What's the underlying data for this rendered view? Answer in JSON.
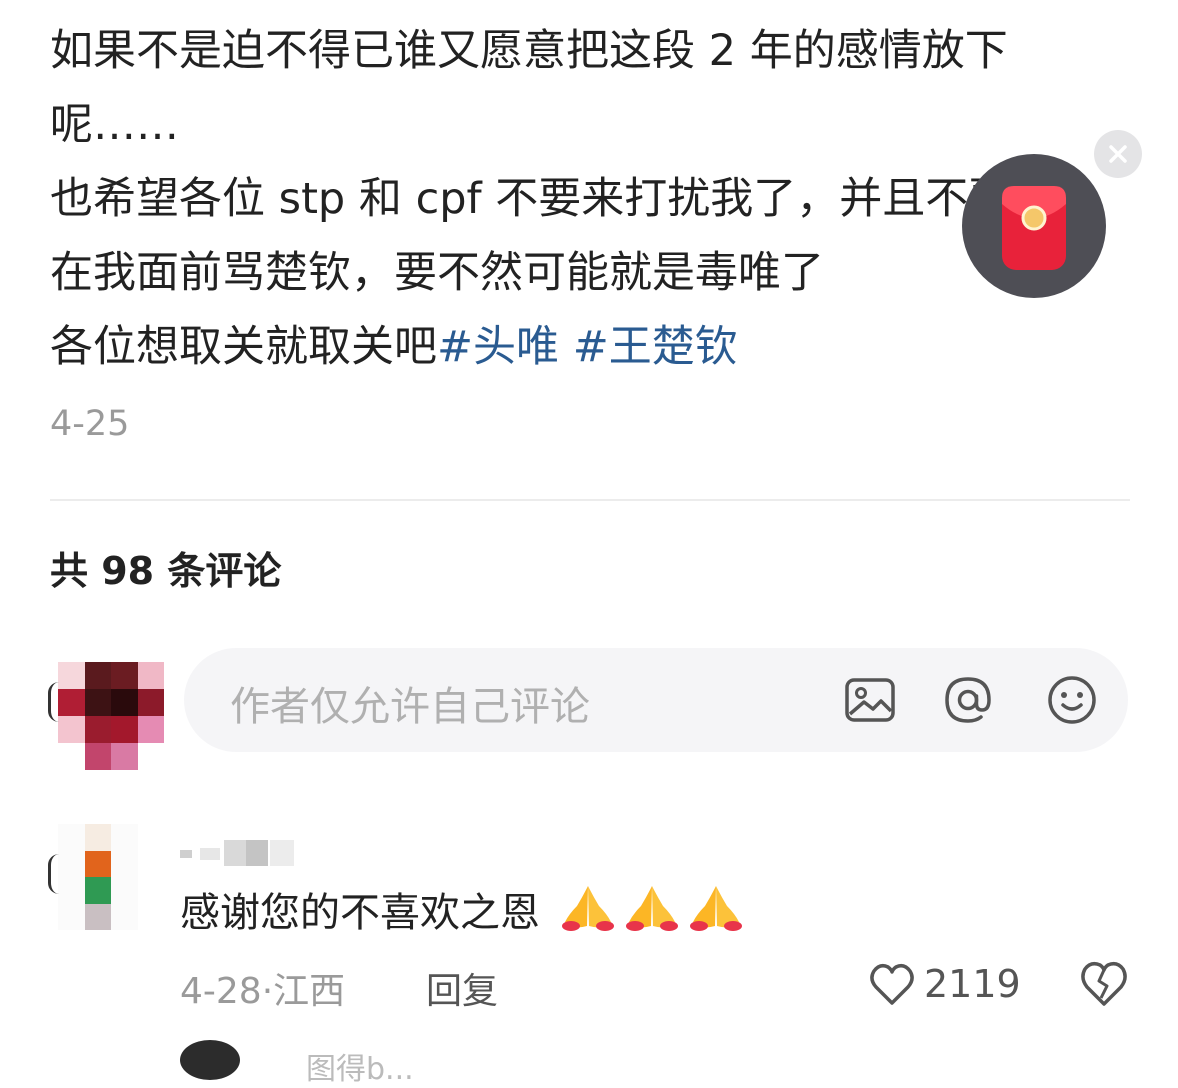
{
  "post": {
    "lines": [
      "如果不是迫不得已谁又愿意把这段 2 年的感情放下",
      "呢……",
      "也希望各位 stp 和 cpf 不要来打扰我了，并且不要",
      "在我面前骂楚钦，要不然可能就是毒唯了",
      "各位想取关就取关吧"
    ],
    "hashtags": [
      "#头唯",
      "#王楚钦"
    ],
    "date": "4-25"
  },
  "comments_header": "共 98 条评论",
  "comment_input": {
    "placeholder": "作者仅允许自己评论",
    "icons": [
      "image-icon",
      "at-icon",
      "emoji-icon"
    ]
  },
  "comment": {
    "text": "感谢您的不喜欢之恩",
    "emoji": [
      "pray-emoji",
      "pray-emoji",
      "pray-emoji"
    ],
    "date": "4-28",
    "location": "江西",
    "reply_label": "回复",
    "likes": "2119"
  },
  "next_comment": {
    "name": "图得b..."
  },
  "colors": {
    "hashtag": "#2a5b91",
    "muted": "#9a9a9a",
    "redpacket": "#e8223a"
  }
}
